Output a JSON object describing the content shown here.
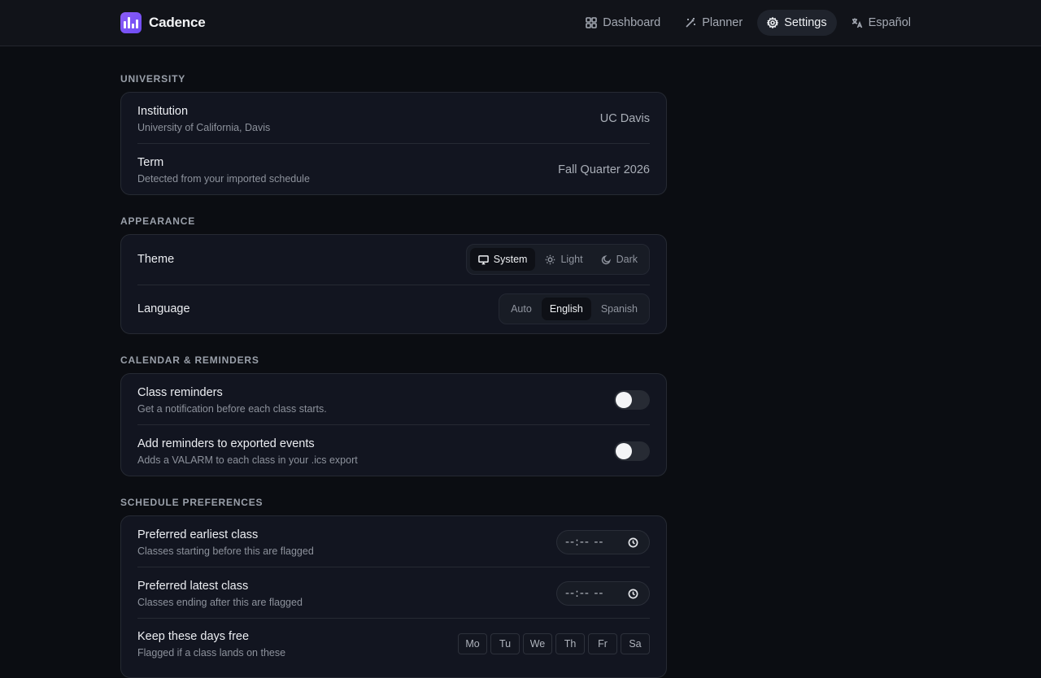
{
  "app": {
    "name": "Cadence"
  },
  "nav": {
    "items": [
      {
        "label": "Dashboard",
        "icon": "grid-icon"
      },
      {
        "label": "Planner",
        "icon": "wand-icon"
      },
      {
        "label": "Settings",
        "icon": "gear-icon",
        "active": true
      },
      {
        "label": "Español",
        "icon": "translate-icon"
      }
    ]
  },
  "university": {
    "title": "UNIVERSITY",
    "institution": {
      "label": "Institution",
      "sub": "University of California, Davis",
      "value": "UC Davis"
    },
    "term": {
      "label": "Term",
      "sub": "Detected from your imported schedule",
      "value": "Fall Quarter 2026"
    }
  },
  "appearance": {
    "title": "APPEARANCE",
    "theme": {
      "label": "Theme",
      "options": [
        "System",
        "Light",
        "Dark"
      ],
      "selected": "System"
    },
    "language": {
      "label": "Language",
      "options": [
        "Auto",
        "English",
        "Spanish"
      ],
      "selected": "English"
    }
  },
  "calendar": {
    "title": "CALENDAR & REMINDERS",
    "class_reminders": {
      "label": "Class reminders",
      "sub": "Get a notification before each class starts.",
      "enabled": false
    },
    "export_reminders": {
      "label": "Add reminders to exported events",
      "sub": "Adds a VALARM to each class in your .ics export",
      "enabled": false
    }
  },
  "schedule": {
    "title": "SCHEDULE PREFERENCES",
    "earliest": {
      "label": "Preferred earliest class",
      "sub": "Classes starting before this are flagged",
      "value": "--:-- --"
    },
    "latest": {
      "label": "Preferred latest class",
      "sub": "Classes ending after this are flagged",
      "value": "--:-- --"
    },
    "free_days": {
      "label": "Keep these days free",
      "sub": "Flagged if a class lands on these",
      "days": [
        "Mo",
        "Tu",
        "We",
        "Th",
        "Fr",
        "Sa"
      ]
    }
  },
  "colors": {
    "accent": "#7c5cf6",
    "background": "#0b0d12",
    "card": "#121520"
  }
}
